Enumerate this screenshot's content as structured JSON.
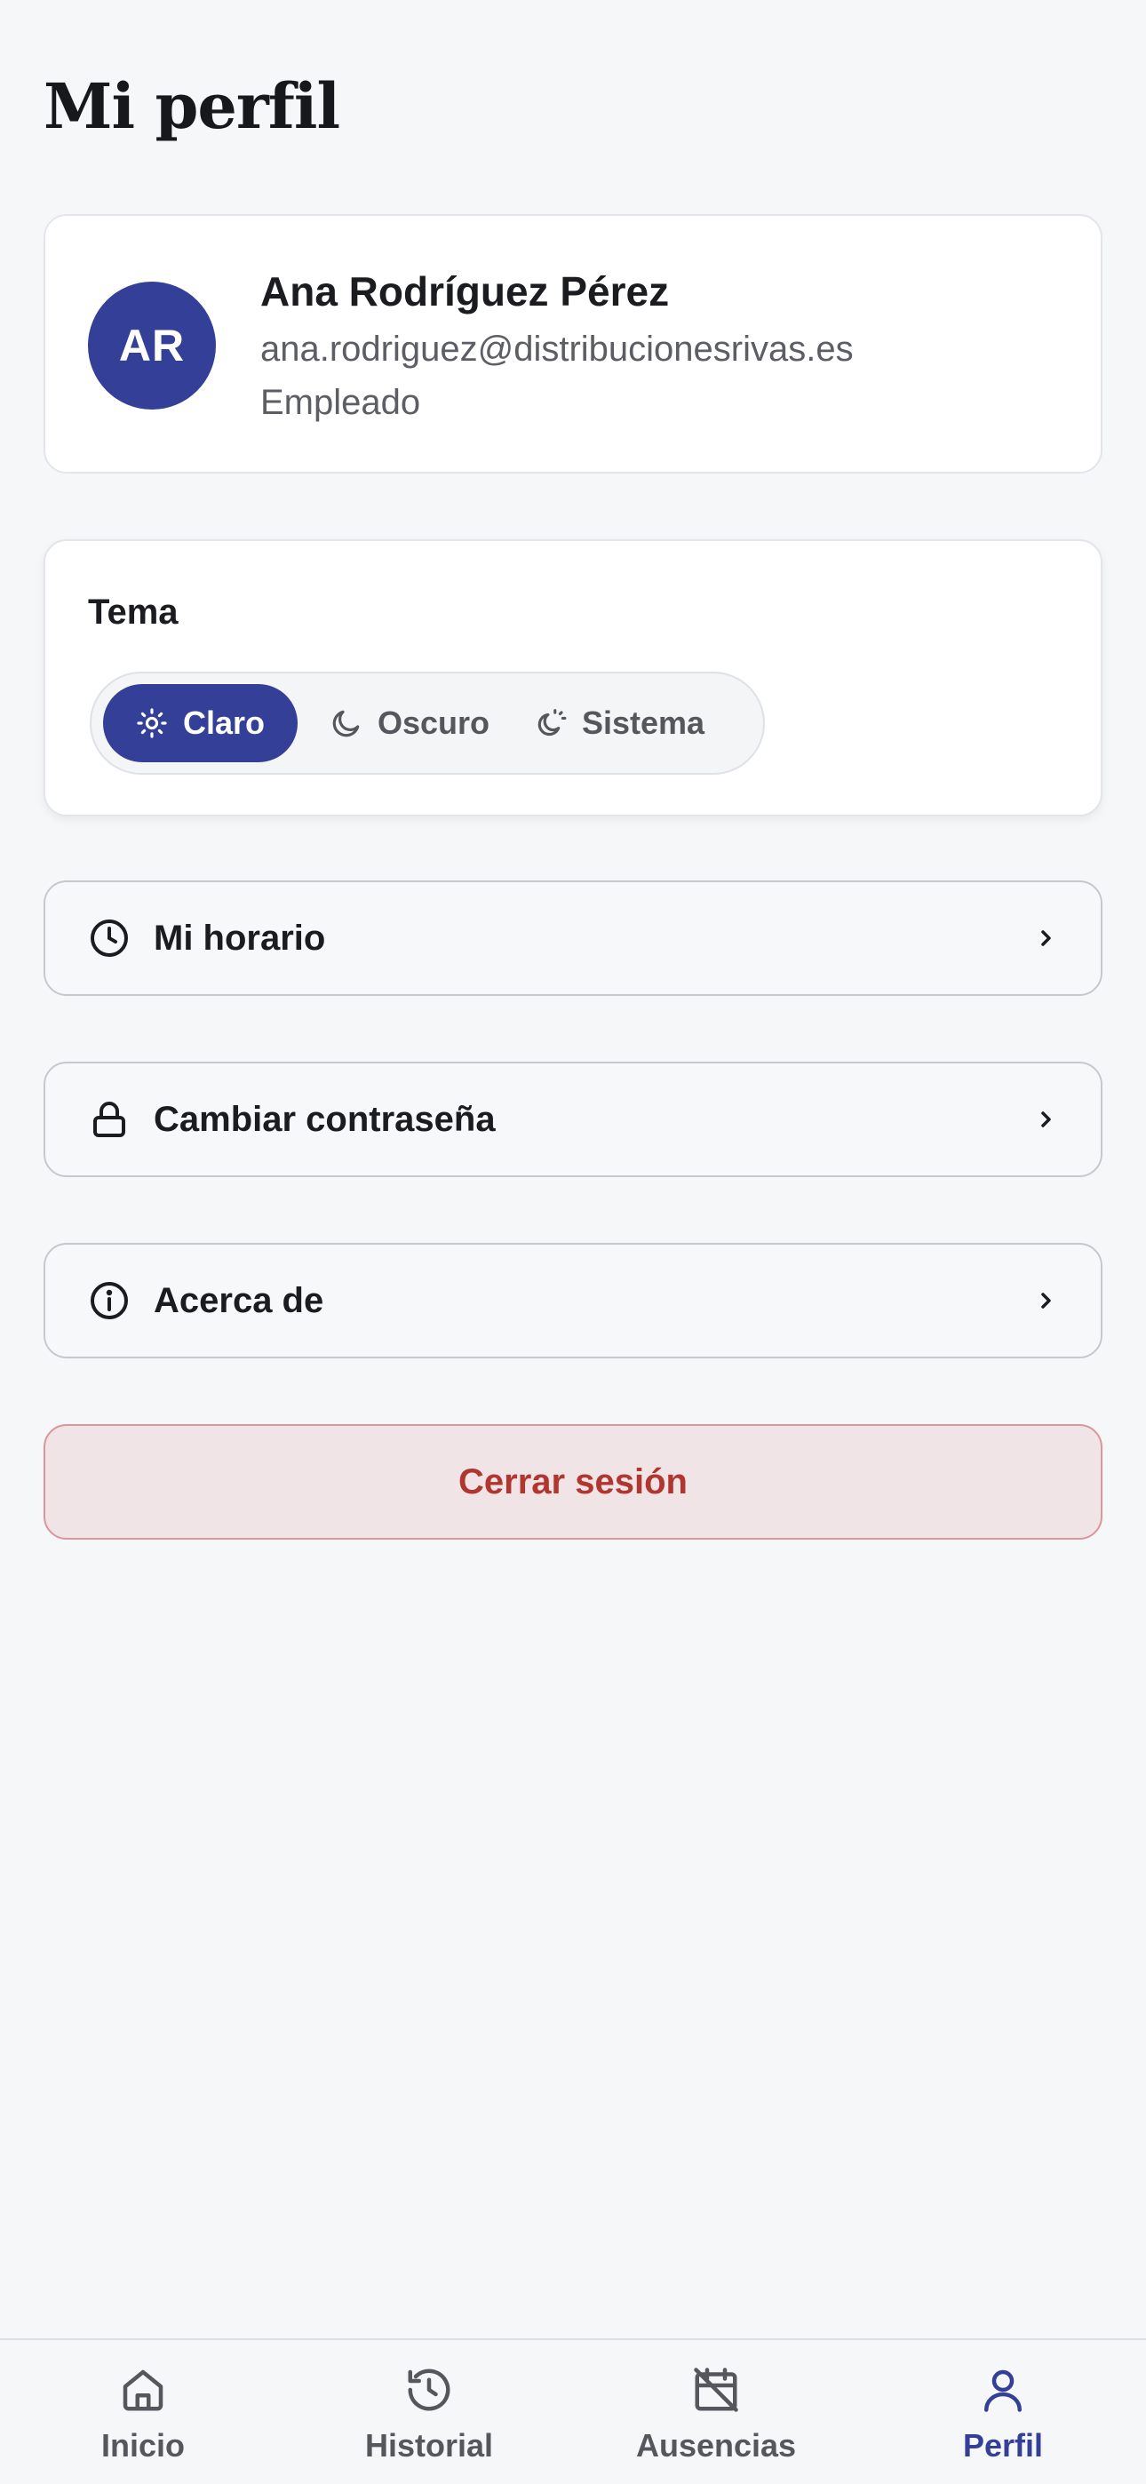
{
  "header": {
    "title": "Mi perfil"
  },
  "profile": {
    "initials": "AR",
    "name": "Ana Rodríguez Pérez",
    "email": "ana.rodriguez@distribucionesrivas.es",
    "role": "Empleado"
  },
  "theme": {
    "label": "Tema",
    "selected": "Claro",
    "options": [
      {
        "label": "Claro",
        "icon": "sun-icon"
      },
      {
        "label": "Oscuro",
        "icon": "moon-icon"
      },
      {
        "label": "Sistema",
        "icon": "sun-moon-icon"
      }
    ]
  },
  "menu": [
    {
      "label": "Mi horario",
      "icon": "clock-icon"
    },
    {
      "label": "Cambiar contraseña",
      "icon": "lock-icon"
    },
    {
      "label": "Acerca de",
      "icon": "info-icon"
    }
  ],
  "logout": {
    "label": "Cerrar sesión"
  },
  "bottom_nav": {
    "active": "Perfil",
    "items": [
      {
        "label": "Inicio",
        "icon": "home-icon"
      },
      {
        "label": "Historial",
        "icon": "history-icon"
      },
      {
        "label": "Ausencias",
        "icon": "calendar-off-icon"
      },
      {
        "label": "Perfil",
        "icon": "user-icon"
      }
    ]
  },
  "colors": {
    "accent": "#343f97",
    "background": "#f6f7f9",
    "danger_text": "#b0362f",
    "danger_bg": "#f0e4e6"
  }
}
